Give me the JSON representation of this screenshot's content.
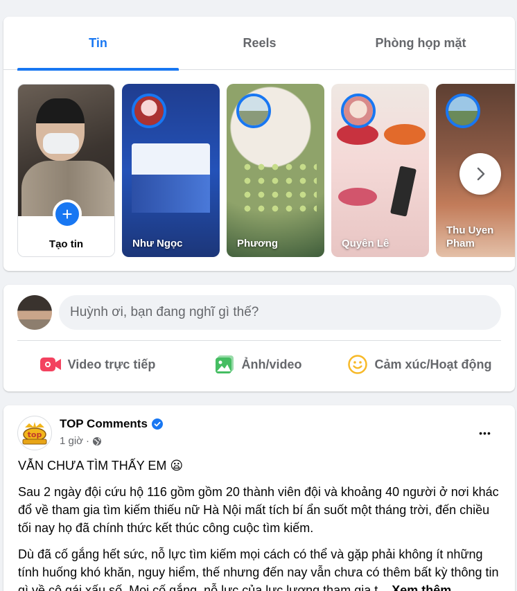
{
  "tabs": [
    {
      "label": "Tin",
      "active": true
    },
    {
      "label": "Reels",
      "active": false
    },
    {
      "label": "Phòng họp mặt",
      "active": false
    }
  ],
  "stories": {
    "create_label": "Tạo tin",
    "create_plus": "+",
    "items": [
      {
        "name": "Như Ngọc"
      },
      {
        "name": "Phương"
      },
      {
        "name": "Quyên Lê"
      },
      {
        "name": "Thu Uyen Pham"
      }
    ],
    "next_icon": "chevron-right-icon"
  },
  "composer": {
    "placeholder": "Huỳnh ơi, bạn đang nghĩ gì thế?",
    "actions": [
      {
        "label": "Video trực tiếp",
        "icon": "live-video-icon",
        "color": "#f3425f"
      },
      {
        "label": "Ảnh/video",
        "icon": "photo-video-icon",
        "color": "#45bd62"
      },
      {
        "label": "Cảm xúc/Hoạt động",
        "icon": "feeling-icon",
        "color": "#f7b928"
      }
    ]
  },
  "post": {
    "author": "TOP Comments",
    "time": "1 giờ",
    "dot": "·",
    "more": "•••",
    "title": "VẪN CHƯA TÌM THẤY EM 😦",
    "paragraph1": "Sau 2 ngày đội cứu hộ 116 gồm gồm 20 thành viên đội và khoảng 40 người ở nơi khác đổ về tham gia tìm kiếm thiếu nữ Hà Nội mất tích bí ẩn suốt một tháng trời, đến chiều tối nay họ đã chính thức kết thúc công cuộc tìm kiếm.",
    "paragraph2": "Dù đã cố gắng hết sức, nỗ lực tìm kiếm mọi cách có thể và gặp phải không ít những tính huống khó khăn, nguy hiểm, thế nhưng đến nay vẫn chưa có thêm bất kỳ thông tin gì về cô gái xấu số. Mọi cố gắng, nỗ lực của lực lượng tham gia t...",
    "see_more": "Xem thêm"
  },
  "colors": {
    "accent": "#1877f2",
    "background": "#f0f2f5",
    "secondary_text": "#65676b"
  }
}
